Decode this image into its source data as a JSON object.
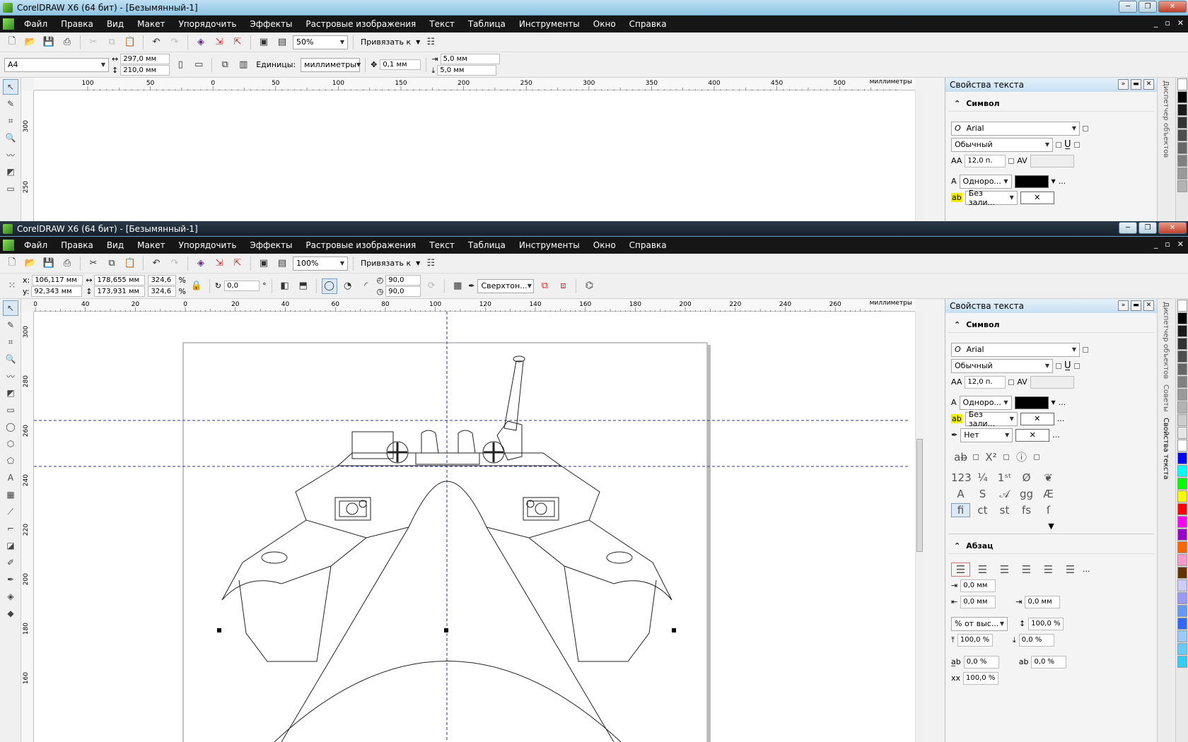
{
  "app": {
    "title": "CorelDRAW X6 (64 бит) - [Безымянный-1]",
    "menu": [
      "Файл",
      "Правка",
      "Вид",
      "Макет",
      "Упорядочить",
      "Эффекты",
      "Растровые изображения",
      "Текст",
      "Таблица",
      "Инструменты",
      "Окно",
      "Справка"
    ]
  },
  "win1": {
    "zoom": "50%",
    "snap_label": "Привязать к",
    "page_size": "A4",
    "width": "297,0 мм",
    "height": "210,0 мм",
    "units_label": "Единицы:",
    "units": "миллиметры",
    "nudge": "0,1 мм",
    "dup_x": "5,0 мм",
    "dup_y": "5,0 мм",
    "hruler_ticks": [
      "100",
      "50",
      "0",
      "50",
      "100",
      "150",
      "200",
      "250",
      "300",
      "350",
      "400",
      "450",
      "500"
    ],
    "hruler_unit": "миллиметры",
    "vruler_ticks": [
      "300",
      "250"
    ]
  },
  "win2": {
    "zoom": "100%",
    "snap_label": "Привязать к",
    "pos_x_label": "x:",
    "pos_x": "106,117 мм",
    "pos_y_label": "y:",
    "pos_y": "92,343 мм",
    "size_w": "178,655 мм",
    "size_h": "173,931 мм",
    "scale_w": "324,6",
    "scale_h": "324,6",
    "percent": "%",
    "rotation": "0,0",
    "degree": "°",
    "angle_start": "90,0",
    "angle_end": "90,0",
    "outline_width": "Сверхтон...",
    "hruler_ticks": [
      "0",
      "40",
      "20",
      "0",
      "20",
      "40",
      "60",
      "80",
      "100",
      "120",
      "140",
      "160",
      "180",
      "200",
      "220",
      "240",
      "260"
    ],
    "hruler_unit": "миллиметры",
    "vruler_ticks": [
      "300",
      "280",
      "260",
      "240",
      "220",
      "200",
      "180",
      "160"
    ]
  },
  "docker": {
    "title": "Свойства текста",
    "char_section": "Символ",
    "font": "Arial",
    "style": "Обычный",
    "size": "12,0 п.",
    "fill_type": "Одноро...",
    "bg_fill": "Без зали...",
    "outline": "Нет",
    "para_section": "Абзац",
    "indent1": "0,0 мм",
    "indent2": "0,0 мм",
    "indent3": "0,0 мм",
    "line_spacing_unit": "% от выс...",
    "line_spacing": "100,0 %",
    "before_para": "100,0 %",
    "after_para": "0,0 %",
    "char_spacing": "0,0 %",
    "word_spacing": "0,0 %",
    "lang_spacing": "100,0 %",
    "more": "...",
    "tab_objects": "Диспетчер объектов",
    "tab_tips": "Советы",
    "tab_text": "Свойства текста"
  },
  "palette_colors": [
    "#ffffff",
    "#000000",
    "#1a1a1a",
    "#333333",
    "#4d4d4d",
    "#666666",
    "#808080",
    "#999999",
    "#b3b3b3",
    "#cccccc",
    "#e6e6e6",
    "#ffffff",
    "#0000ff",
    "#00ffff",
    "#00ff00",
    "#ffff00",
    "#ff0000",
    "#ff00ff",
    "#9900cc",
    "#ff6600",
    "#ff99cc",
    "#663300",
    "#ccccff",
    "#9999ff",
    "#6699ff",
    "#3366ff",
    "#99ccff",
    "#66ccff",
    "#33ccff"
  ]
}
